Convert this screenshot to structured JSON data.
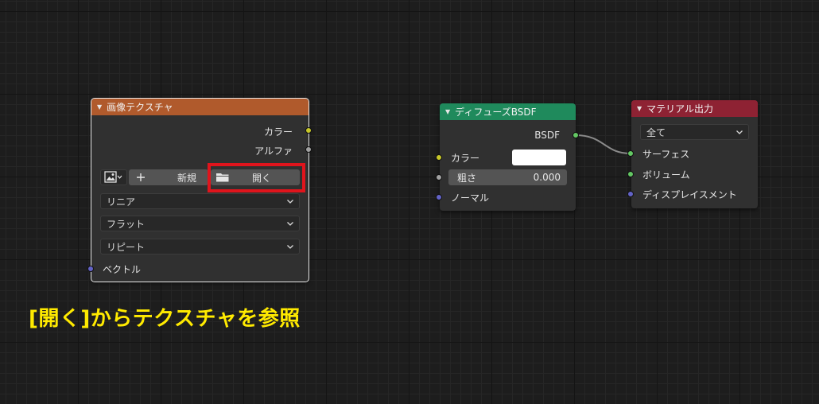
{
  "colors": {
    "image_texture_header": "#b05a2c",
    "diffuse_header": "#1f8a5c",
    "material_output_header": "#8e2233",
    "caption": "#ffea00",
    "highlight": "#e0141c"
  },
  "image_texture_node": {
    "title": "画像テクスチャ",
    "outputs": [
      "カラー",
      "アルファ"
    ],
    "new_label": "新規",
    "open_label": "開く",
    "interpolation": "リニア",
    "projection": "フラット",
    "extension": "リピート",
    "vector_input": "ベクトル",
    "icons": [
      "image-browse-icon",
      "plus-icon",
      "folder-icon"
    ]
  },
  "diffuse_node": {
    "title": "ディフューズBSDF",
    "output": "BSDF",
    "color_label": "カラー",
    "roughness_label": "粗さ",
    "roughness_value": "0.000",
    "normal_label": "ノーマル"
  },
  "material_output_node": {
    "title": "マテリアル出力",
    "target": "全て",
    "inputs": [
      "サーフェス",
      "ボリューム",
      "ディスプレイスメント"
    ]
  },
  "caption": "[開く]からテクスチャを参照"
}
